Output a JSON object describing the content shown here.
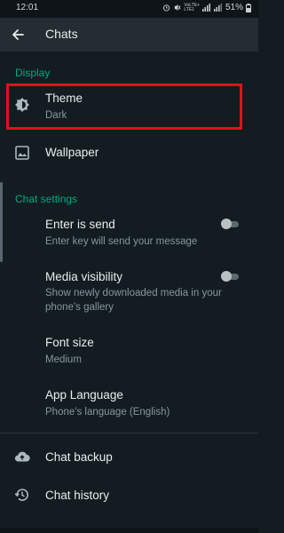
{
  "status": {
    "time": "12:01",
    "net1": "VoLTE+",
    "net2": "LTE1",
    "battery": "51%"
  },
  "app_bar": {
    "title": "Chats"
  },
  "display": {
    "header": "Display",
    "theme": {
      "title": "Theme",
      "value": "Dark"
    },
    "wallpaper": {
      "title": "Wallpaper"
    }
  },
  "chat_settings": {
    "header": "Chat settings",
    "enter_is_send": {
      "title": "Enter is send",
      "subtitle": "Enter key will send your message",
      "on": false
    },
    "media_visibility": {
      "title": "Media visibility",
      "subtitle": "Show newly downloaded media in your phone's gallery",
      "on": false
    },
    "font_size": {
      "title": "Font size",
      "value": "Medium"
    },
    "app_language": {
      "title": "App Language",
      "value": "Phone's language (English)"
    }
  },
  "other": {
    "chat_backup": "Chat backup",
    "chat_history": "Chat history"
  },
  "colors": {
    "background": "#131c21",
    "accent": "#00a884",
    "highlight": "#e2101d"
  }
}
